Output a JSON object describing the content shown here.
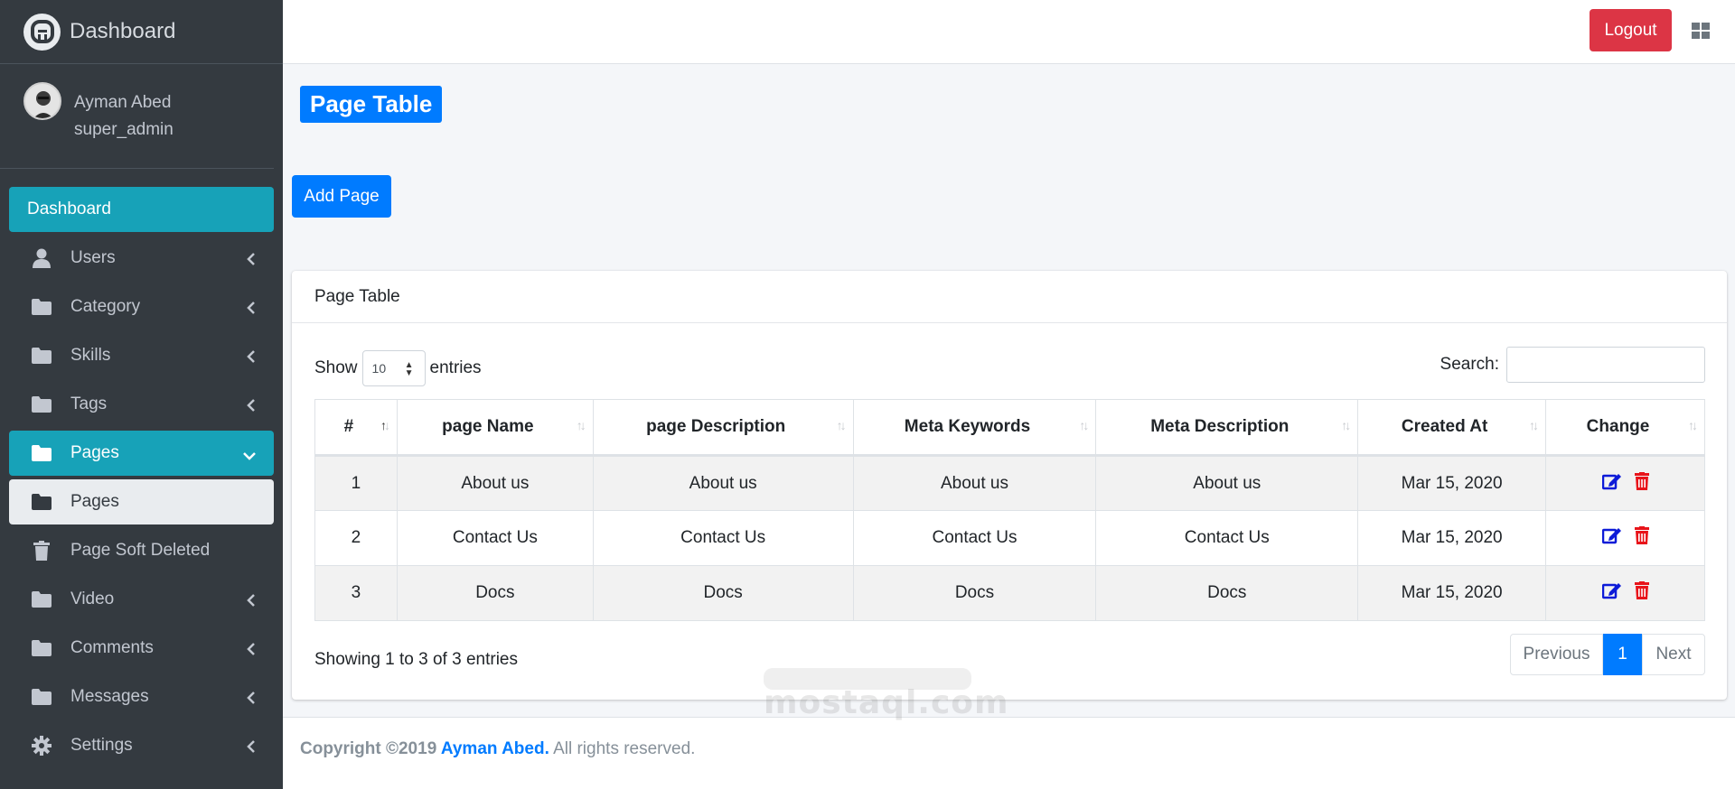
{
  "brand": {
    "title": "Dashboard"
  },
  "user": {
    "name": "Ayman Abed",
    "role": "super_admin"
  },
  "sidebar": {
    "items": [
      {
        "label": "Dashboard"
      },
      {
        "label": "Users"
      },
      {
        "label": "Category"
      },
      {
        "label": "Skills"
      },
      {
        "label": "Tags"
      },
      {
        "label": "Pages"
      },
      {
        "label": "Pages"
      },
      {
        "label": "Page Soft Deleted"
      },
      {
        "label": "Video"
      },
      {
        "label": "Comments"
      },
      {
        "label": "Messages"
      },
      {
        "label": "Settings"
      }
    ]
  },
  "topbar": {
    "logout_label": "Logout"
  },
  "page": {
    "title": "Page Table",
    "add_label": "Add Page"
  },
  "card": {
    "title": "Page Table",
    "show_label": "Show",
    "entries_label": "entries",
    "page_length": "10",
    "search_label": "Search:",
    "search_value": ""
  },
  "table": {
    "columns": [
      "#",
      "page Name",
      "page Description",
      "Meta Keywords",
      "Meta Description",
      "Created At",
      "Change"
    ],
    "rows": [
      {
        "id": "1",
        "name": "About us",
        "description": "About us",
        "keywords": "About us",
        "meta_description": "About us",
        "created": "Mar 15, 2020"
      },
      {
        "id": "2",
        "name": "Contact Us",
        "description": "Contact Us",
        "keywords": "Contact Us",
        "meta_description": "Contact Us",
        "created": "Mar 15, 2020"
      },
      {
        "id": "3",
        "name": "Docs",
        "description": "Docs",
        "keywords": "Docs",
        "meta_description": "Docs",
        "created": "Mar 15, 2020"
      }
    ]
  },
  "pagination": {
    "info": "Showing 1 to 3 of 3 entries",
    "prev": "Previous",
    "current": "1",
    "next": "Next"
  },
  "footer": {
    "prefix": "Copyright ©2019 ",
    "name": "Ayman Abed.",
    "suffix": " All rights reserved."
  },
  "watermark": {
    "text": "mostaql.com"
  },
  "colors": {
    "sidebar": "#343a40",
    "active": "#17a2b8",
    "primary": "#007bff",
    "danger": "#dc3545",
    "edit_icon": "#0d1bd8",
    "delete_icon": "#e8141a"
  }
}
